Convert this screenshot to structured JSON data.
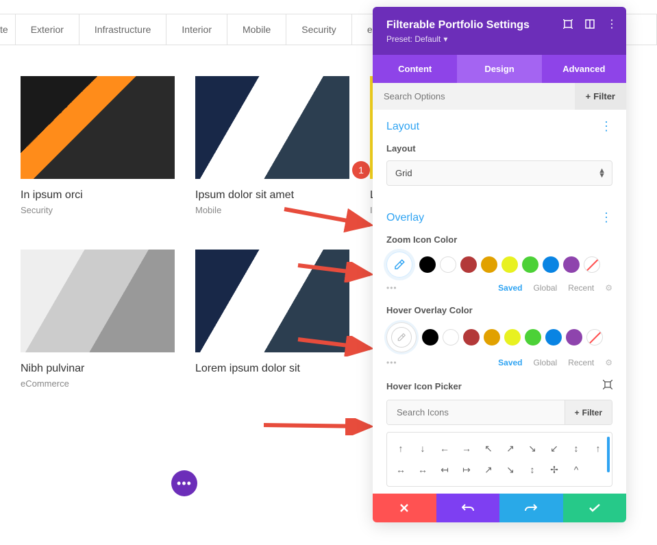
{
  "filter_tabs": [
    "te",
    "Exterior",
    "Infrastructure",
    "Interior",
    "Mobile",
    "Security",
    "eCon"
  ],
  "portfolio": [
    {
      "title": "In ipsum orci",
      "category": "Security"
    },
    {
      "title": "Ipsum dolor sit amet",
      "category": "Mobile"
    },
    {
      "title": "Ligula sed magna",
      "category": "Infrastructure"
    },
    {
      "title": "Nibh pulvinar",
      "category": "eCommerce"
    },
    {
      "title": "Lorem ipsum dolor sit",
      "category": ""
    }
  ],
  "badge": "1",
  "panel": {
    "title": "Filterable Portfolio Settings",
    "preset": "Preset: Default",
    "tabs": {
      "content": "Content",
      "design": "Design",
      "advanced": "Advanced"
    },
    "search_placeholder": "Search Options",
    "filter_btn": "Filter",
    "layout": {
      "section_title": "Layout",
      "field_label": "Layout",
      "value": "Grid"
    },
    "overlay": {
      "section_title": "Overlay",
      "zoom_label": "Zoom Icon Color",
      "hover_overlay_label": "Hover Overlay Color",
      "hover_icon_label": "Hover Icon Picker",
      "saved": "Saved",
      "global": "Global",
      "recent": "Recent",
      "icon_search_placeholder": "Search Icons",
      "icon_filter_btn": "Filter"
    },
    "colors": [
      "#000000",
      "#ffffff",
      "#b33939",
      "#e1a100",
      "#e8f121",
      "#4cd137",
      "#0984e3",
      "#8e44ad"
    ],
    "icons_row1": [
      "↑",
      "↓",
      "←",
      "→",
      "↖",
      "↗",
      "↘",
      "↙",
      "↕",
      "↑"
    ],
    "icons_row2": [
      "↔",
      "↔",
      "↤",
      "↦",
      "↗",
      "↘",
      "↕",
      "✢",
      "^",
      ""
    ]
  }
}
